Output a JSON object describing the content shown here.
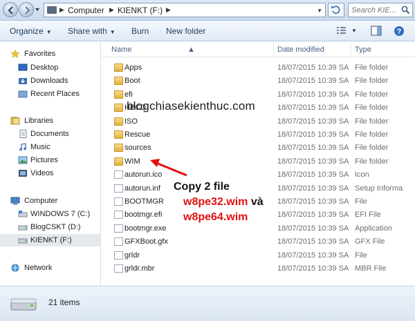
{
  "address": {
    "crumbs": [
      "Computer",
      "KIENKT (F:)"
    ],
    "search_placeholder": "Search KIE..."
  },
  "toolbar": {
    "organize": "Organize",
    "share_with": "Share with",
    "burn": "Burn",
    "new_folder": "New folder"
  },
  "nav": {
    "favorites": "Favorites",
    "desktop": "Desktop",
    "downloads": "Downloads",
    "recent_places": "Recent Places",
    "libraries": "Libraries",
    "documents": "Documents",
    "music": "Music",
    "pictures": "Pictures",
    "videos": "Videos",
    "computer": "Computer",
    "drive_c": "WINDOWS 7 (C:)",
    "drive_d": "BlogCSKT (D:)",
    "drive_f": "KIENKT (F:)",
    "network": "Network"
  },
  "columns": {
    "name": "Name",
    "date": "Date modified",
    "type": "Type"
  },
  "files": [
    {
      "name": "Apps",
      "date": "18/07/2015 10:39 SA",
      "type": "File folder",
      "kind": "folder"
    },
    {
      "name": "Boot",
      "date": "18/07/2015 10:39 SA",
      "type": "File folder",
      "kind": "folder"
    },
    {
      "name": "efi",
      "date": "18/07/2015 10:39 SA",
      "type": "File folder",
      "kind": "folder"
    },
    {
      "name": "HBCD",
      "date": "18/07/2015 10:39 SA",
      "type": "File folder",
      "kind": "folder"
    },
    {
      "name": "ISO",
      "date": "18/07/2015 10:39 SA",
      "type": "File folder",
      "kind": "folder"
    },
    {
      "name": "Rescue",
      "date": "18/07/2015 10:39 SA",
      "type": "File folder",
      "kind": "folder"
    },
    {
      "name": "sources",
      "date": "18/07/2015 10:39 SA",
      "type": "File folder",
      "kind": "folder"
    },
    {
      "name": "WIM",
      "date": "18/07/2015 10:39 SA",
      "type": "File folder",
      "kind": "folder"
    },
    {
      "name": "autorun.ico",
      "date": "18/07/2015 10:39 SA",
      "type": "Icon",
      "kind": "file"
    },
    {
      "name": "autorun.inf",
      "date": "18/07/2015 10:39 SA",
      "type": "Setup Informa",
      "kind": "file"
    },
    {
      "name": "BOOTMGR",
      "date": "18/07/2015 10:39 SA",
      "type": "File",
      "kind": "file"
    },
    {
      "name": "bootmgr.efi",
      "date": "18/07/2015 10:39 SA",
      "type": "EFI File",
      "kind": "file"
    },
    {
      "name": "bootmgr.exe",
      "date": "18/07/2015 10:39 SA",
      "type": "Application",
      "kind": "file"
    },
    {
      "name": "GFXBoot.gfx",
      "date": "18/07/2015 10:39 SA",
      "type": "GFX File",
      "kind": "file"
    },
    {
      "name": "grldr",
      "date": "18/07/2015 10:39 SA",
      "type": "File",
      "kind": "file"
    },
    {
      "name": "grldr.mbr",
      "date": "18/07/2015 10:39 SA",
      "type": "MBR File",
      "kind": "file"
    }
  ],
  "status": {
    "item_count": "21 items"
  },
  "annotation": {
    "line1": "Copy 2 file",
    "file1": "w8pe32.wim",
    "and": " và",
    "file2": "w8pe64.wim",
    "watermark": "blogchiasekienthuc.com"
  },
  "colors": {
    "annotation_red": "#e01010",
    "folder_yellow": "#e5b23f",
    "link_blue": "#1e3a5f"
  }
}
